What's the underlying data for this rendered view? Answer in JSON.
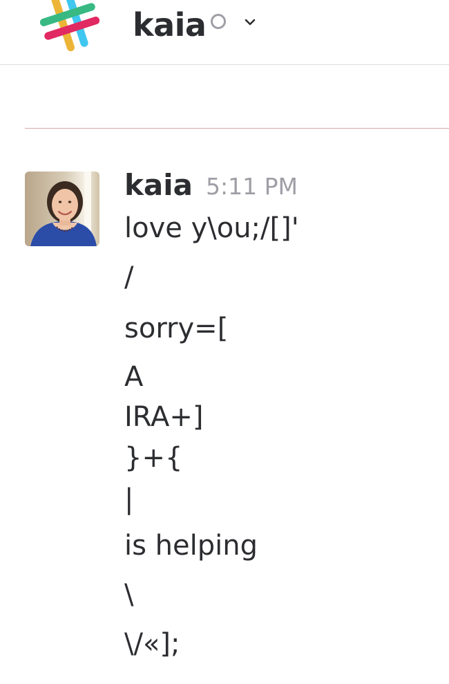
{
  "header": {
    "team_name": "kaia",
    "presence_status": "away",
    "logo_icon": "slack-hash-logo-icon",
    "dropdown_icon": "chevron-down-icon"
  },
  "colors": {
    "logo_blue": "#36c5f0",
    "logo_green": "#2eb67d",
    "logo_yellow": "#ecb22e",
    "logo_red": "#e01e5a",
    "divider": "#d9a7ad",
    "timestamp": "#9e9ea6",
    "text": "#2c2d30"
  },
  "message": {
    "sender": "kaia",
    "timestamp": "5:11 PM",
    "avatar": "user-avatar-photo",
    "lines": [
      "love y\\ou;/[]'",
      "/",
      "sorry=[",
      "A",
      "IRA+]",
      "}+{",
      "|",
      "is helping",
      "\\",
      "\\/«];"
    ]
  }
}
